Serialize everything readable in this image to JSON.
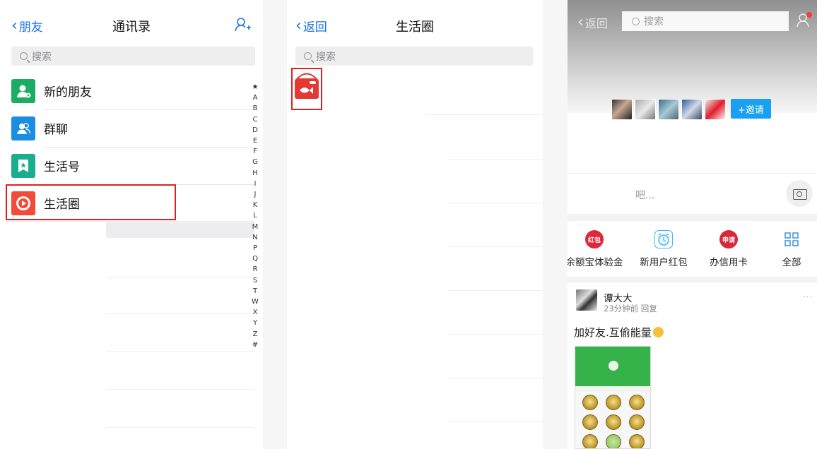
{
  "contacts": {
    "back_label": "朋友",
    "title": "通讯录",
    "add_icon": "add-contact-icon",
    "search_placeholder": "搜索",
    "items": [
      {
        "label": "新的朋友",
        "icon": "new-friend-icon",
        "color": "#1aad63"
      },
      {
        "label": "群聊",
        "icon": "group-chat-icon",
        "color": "#1a8ee0"
      },
      {
        "label": "生活号",
        "icon": "life-account-icon",
        "color": "#1aad8e"
      },
      {
        "label": "生活圈",
        "icon": "life-circle-icon",
        "color": "#f24b3a"
      }
    ],
    "alphabet": [
      "★",
      "A",
      "B",
      "C",
      "D",
      "E",
      "F",
      "G",
      "H",
      "I",
      "J",
      "K",
      "L",
      "M",
      "N",
      "P",
      "Q",
      "R",
      "S",
      "T",
      "W",
      "X",
      "Y",
      "Z",
      "#"
    ]
  },
  "circle": {
    "back_label": "返回",
    "title": "生活圈",
    "search_placeholder": "搜索"
  },
  "detail": {
    "back_label": "返回",
    "search_placeholder": "搜索",
    "invite_label": "+邀请",
    "status_placeholder": "吧...",
    "quick_actions": [
      {
        "label": "余额宝体验金",
        "icon_text": "红包",
        "color": "#e0283c"
      },
      {
        "label": "新用户红包",
        "icon_text": "",
        "color": "#3fb9ef"
      },
      {
        "label": "办信用卡",
        "icon_text": "申请",
        "color": "#d9283a"
      },
      {
        "label": "全部",
        "icon_text": "",
        "color": "#2a8ae0"
      }
    ],
    "post": {
      "author": "谭大大",
      "meta": "23分钟前 回复",
      "text": "加好友.互偷能量",
      "more": "···"
    }
  }
}
